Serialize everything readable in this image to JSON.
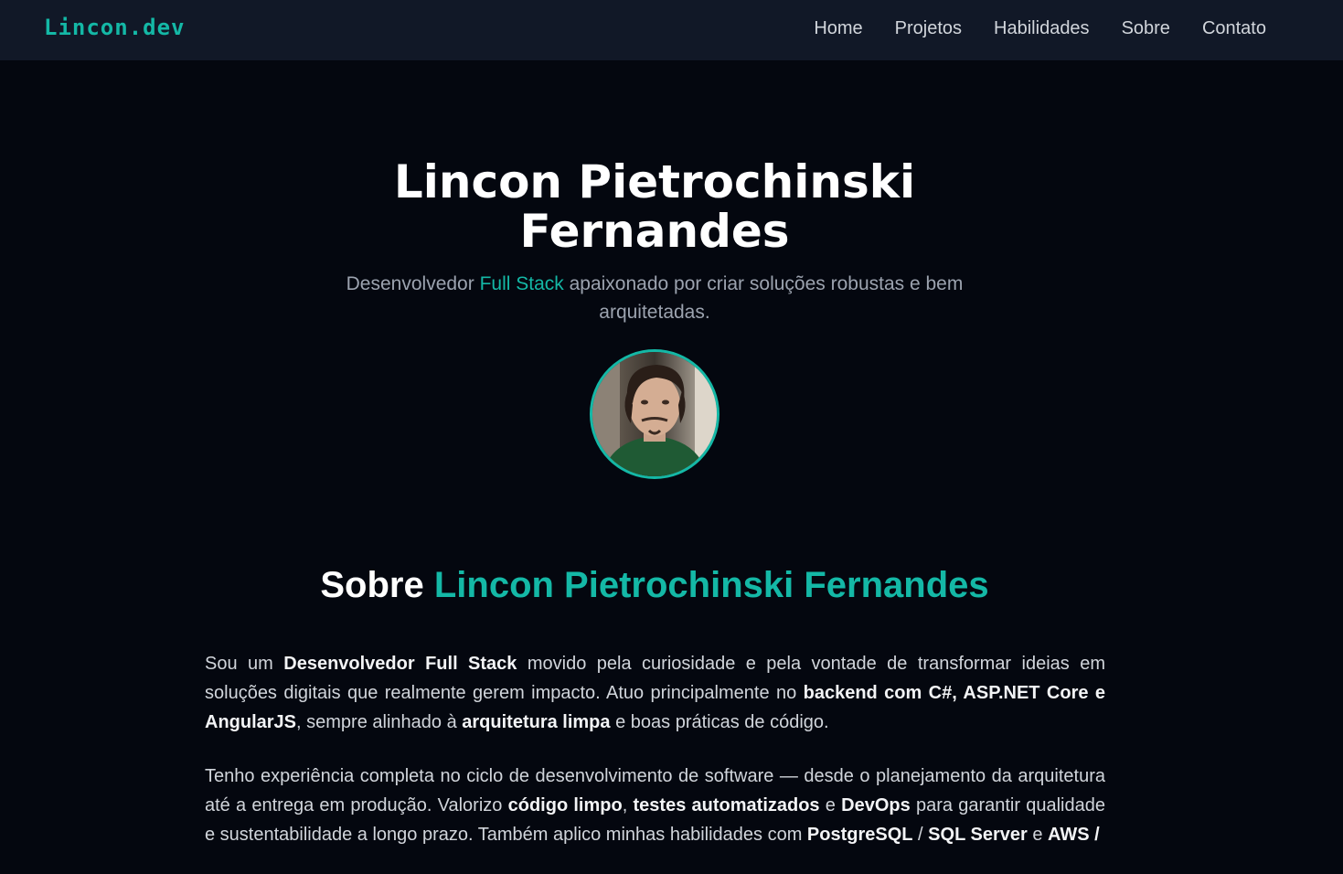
{
  "navbar": {
    "brand": "Lincon.dev",
    "links": [
      {
        "label": "Home"
      },
      {
        "label": "Projetos"
      },
      {
        "label": "Habilidades"
      },
      {
        "label": "Sobre"
      },
      {
        "label": "Contato"
      }
    ]
  },
  "hero": {
    "title_line1": "Lincon Pietrochinski",
    "title_line2": "Fernandes",
    "subtitle_pre": "Desenvolvedor ",
    "subtitle_accent": "Full Stack",
    "subtitle_post": " apaixonado por criar soluções robustas e bem arquitetadas."
  },
  "about": {
    "title_pre": "Sobre ",
    "title_accent": "Lincon Pietrochinski Fernandes",
    "p1": [
      {
        "t": "Sou um ",
        "b": false
      },
      {
        "t": "Desenvolvedor Full Stack",
        "b": true
      },
      {
        "t": " movido pela curiosidade e pela vontade de transformar ideias em soluções digitais que realmente gerem impacto. Atuo principalmente no ",
        "b": false
      },
      {
        "t": "backend com C#, ASP.NET Core e AngularJS",
        "b": true
      },
      {
        "t": ", sempre alinhado à ",
        "b": false
      },
      {
        "t": "arquitetura limpa",
        "b": true
      },
      {
        "t": " e boas práticas de código.",
        "b": false
      }
    ],
    "p2": [
      {
        "t": "Tenho experiência completa no ciclo de desenvolvimento de software — desde o planejamento da arquitetura até a entrega em produção. Valorizo ",
        "b": false
      },
      {
        "t": "código limpo",
        "b": true
      },
      {
        "t": ", ",
        "b": false
      },
      {
        "t": "testes automatizados",
        "b": true
      },
      {
        "t": " e ",
        "b": false
      },
      {
        "t": "DevOps",
        "b": true
      },
      {
        "t": " para garantir qualidade e sustentabilidade a longo prazo. Também aplico minhas habilidades com ",
        "b": false
      },
      {
        "t": "PostgreSQL",
        "b": true
      },
      {
        "t": " / ",
        "b": false
      },
      {
        "t": "SQL Server",
        "b": true
      },
      {
        "t": " e ",
        "b": false
      },
      {
        "t": "AWS /",
        "b": true
      }
    ]
  },
  "colors": {
    "accent": "#14b8a6",
    "navbar_bg": "#111827",
    "page_bg": "#04070f"
  }
}
